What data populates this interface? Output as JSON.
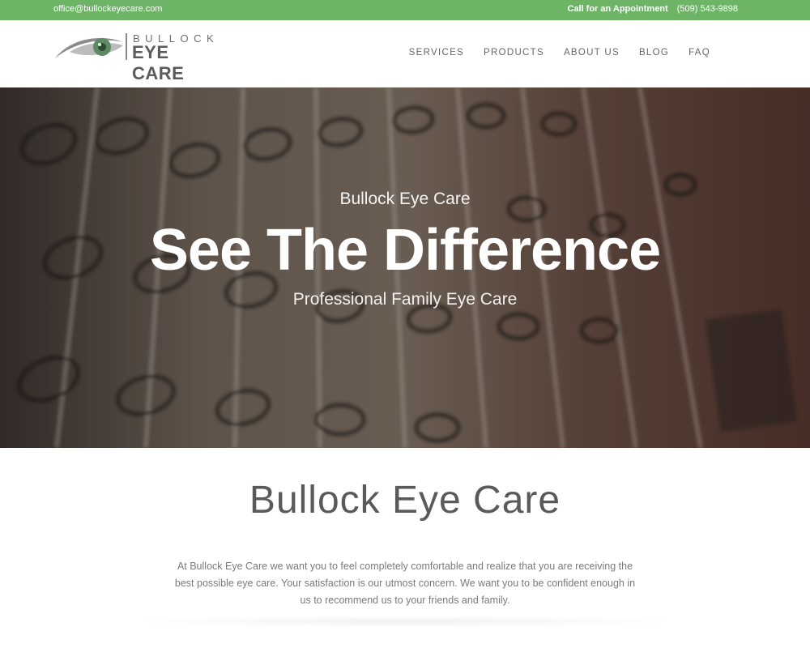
{
  "topbar": {
    "email": "office@bullockeyecare.com",
    "appointment_label": "Call for an Appointment",
    "phone": "(509) 543-9898"
  },
  "logo": {
    "line1": "BULLOCK",
    "line2": "EYE CARE",
    "icon": "eye-icon"
  },
  "nav": {
    "items": [
      {
        "label": "SERVICES"
      },
      {
        "label": "PRODUCTS"
      },
      {
        "label": "ABOUT US"
      },
      {
        "label": "BLOG"
      },
      {
        "label": "FAQ"
      }
    ]
  },
  "hero": {
    "tagline": "Bullock Eye Care",
    "headline": "See The Difference",
    "subheadline": "Professional Family Eye Care"
  },
  "intro": {
    "title": "Bullock Eye Care",
    "paragraph": "At Bullock Eye Care we want you to feel completely comfortable and realize that you are receiving the best possible eye care. Your satisfaction is our utmost concern. We want you to be confident enough in us to recommend us to your friends and family."
  },
  "colors": {
    "topbar": "#6db466",
    "nav_text": "#666666",
    "heading": "#5a5a5a"
  }
}
